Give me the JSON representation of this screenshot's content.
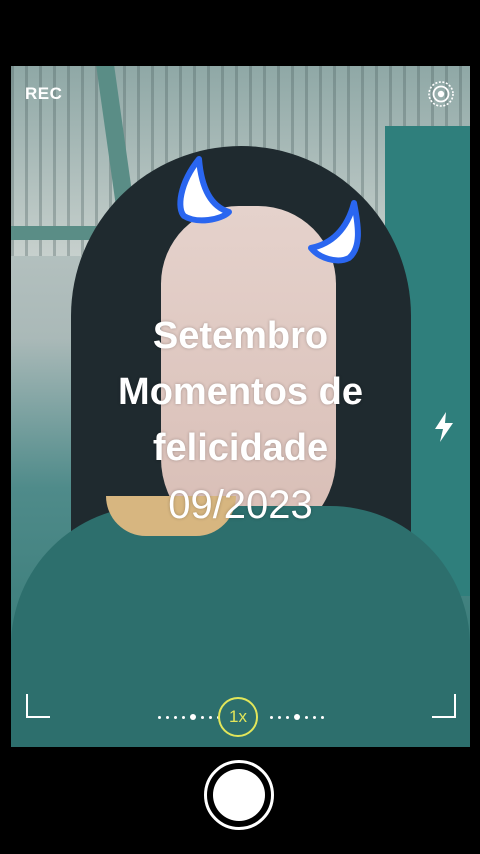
{
  "top_bar": {
    "rec_label": "REC",
    "settings_icon": "concentric-circle-icon"
  },
  "caption": {
    "line1": "Setembro",
    "line2": "Momentos de",
    "line3": "felicidade",
    "date": "09/2023"
  },
  "controls": {
    "flash_icon": "flash-icon",
    "zoom_label": "1x",
    "shutter_icon": "shutter-button"
  },
  "colors": {
    "zoom_accent": "#e2e65a",
    "horn_blue": "#2a66f0"
  }
}
